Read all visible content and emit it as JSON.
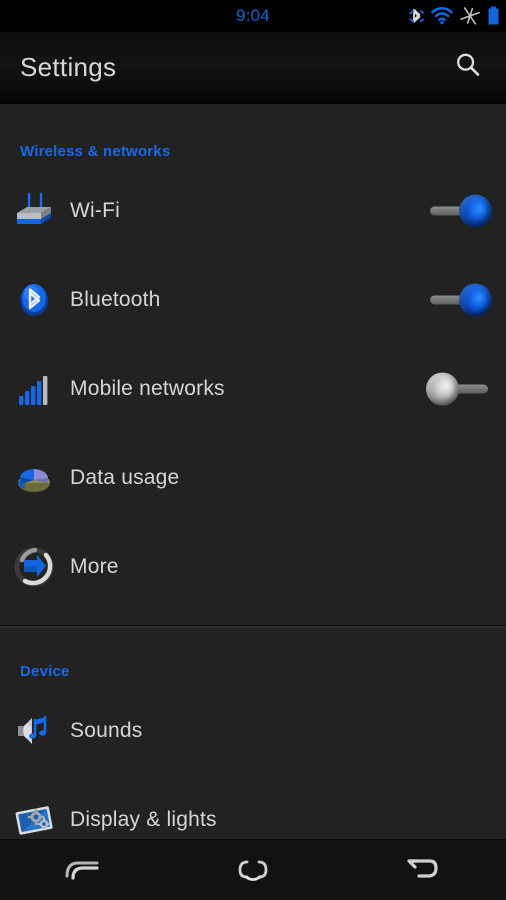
{
  "status_bar": {
    "time": "9:04",
    "icons": [
      {
        "name": "bluetooth-icon",
        "label": "Bluetooth"
      },
      {
        "name": "wifi-icon",
        "label": "Wi-Fi signal"
      },
      {
        "name": "airplane-icon",
        "label": "Airplane"
      },
      {
        "name": "battery-icon",
        "label": "Battery"
      }
    ]
  },
  "action_bar": {
    "title": "Settings",
    "search_label": "Search"
  },
  "colors": {
    "accent_blue": "#1769ed",
    "status_time_blue": "#1565d8",
    "background": "#222222",
    "action_bar": "#0d0d0d",
    "label_text": "#d6d6d6",
    "toggle_on": "#1164e6",
    "toggle_off": "#cfcfcf",
    "nav_bar": "#121212"
  },
  "sections": [
    {
      "title": "Wireless & networks",
      "rows": [
        {
          "label": "Wi-Fi",
          "icon": "router-icon",
          "control": "toggle",
          "toggle_state": "on"
        },
        {
          "label": "Bluetooth",
          "icon": "bluetooth-icon",
          "control": "toggle",
          "toggle_state": "on"
        },
        {
          "label": "Mobile networks",
          "icon": "signal-bars-icon",
          "control": "toggle",
          "toggle_state": "off"
        },
        {
          "label": "Data usage",
          "icon": "pie-chart-icon",
          "control": "none",
          "toggle_state": ""
        },
        {
          "label": "More",
          "icon": "arrow-circle-icon",
          "control": "none",
          "toggle_state": ""
        }
      ]
    },
    {
      "title": "Device",
      "rows": [
        {
          "label": "Sounds",
          "icon": "speaker-notes-icon",
          "control": "none",
          "toggle_state": ""
        },
        {
          "label": "Display & lights",
          "icon": "display-gear-icon",
          "control": "none",
          "toggle_state": ""
        }
      ]
    }
  ],
  "nav_bar": {
    "buttons": [
      {
        "name": "recents-button",
        "label": "Recents"
      },
      {
        "name": "home-button",
        "label": "Home"
      },
      {
        "name": "back-button",
        "label": "Back"
      }
    ]
  }
}
